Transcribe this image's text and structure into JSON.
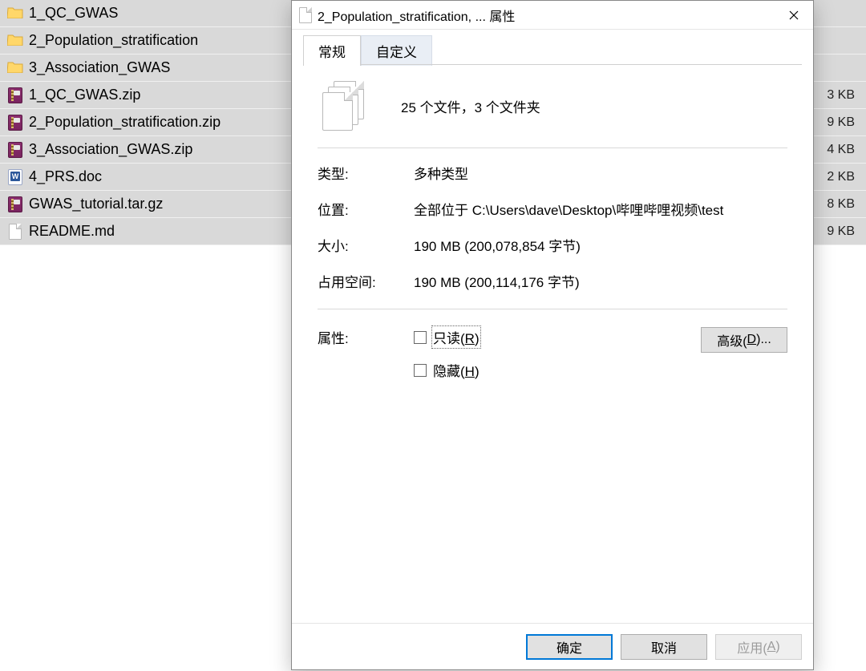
{
  "file_list": {
    "rows": [
      {
        "name": "1_QC_GWAS",
        "icon": "folder",
        "selected": true,
        "size": ""
      },
      {
        "name": "2_Population_stratification",
        "icon": "folder",
        "selected": true,
        "size": ""
      },
      {
        "name": "3_Association_GWAS",
        "icon": "folder",
        "selected": true,
        "size": ""
      },
      {
        "name": "1_QC_GWAS.zip",
        "icon": "archive",
        "selected": true,
        "size": "3 KB"
      },
      {
        "name": "2_Population_stratification.zip",
        "icon": "archive",
        "selected": true,
        "size": "9 KB"
      },
      {
        "name": "3_Association_GWAS.zip",
        "icon": "archive",
        "selected": true,
        "size": "4 KB"
      },
      {
        "name": "4_PRS.doc",
        "icon": "doc",
        "selected": true,
        "size": "2 KB"
      },
      {
        "name": "GWAS_tutorial.tar.gz",
        "icon": "archive",
        "selected": true,
        "size": "8 KB"
      },
      {
        "name": "README.md",
        "icon": "file",
        "selected": true,
        "size": "9 KB"
      }
    ]
  },
  "dialog": {
    "title": "2_Population_stratification, ... 属性",
    "tabs": {
      "general": "常规",
      "custom": "自定义"
    },
    "summary": "25 个文件，3 个文件夹",
    "labels": {
      "type": "类型:",
      "location": "位置:",
      "size": "大小:",
      "size_on_disk": "占用空间:",
      "attributes": "属性:"
    },
    "values": {
      "type": "多种类型",
      "location": "全部位于 C:\\Users\\dave\\Desktop\\哔哩哔哩视频\\test",
      "size": "190 MB (200,078,854 字节)",
      "size_on_disk": "190 MB (200,114,176 字节)"
    },
    "checkboxes": {
      "readonly_prefix": "只读(",
      "readonly_key": "R",
      "readonly_suffix": ")",
      "hidden_prefix": "隐藏(",
      "hidden_key": "H",
      "hidden_suffix": ")"
    },
    "buttons": {
      "advanced_prefix": "高级(",
      "advanced_key": "D",
      "advanced_suffix": ")...",
      "ok": "确定",
      "cancel": "取消",
      "apply_prefix": "应用(",
      "apply_key": "A",
      "apply_suffix": ")"
    }
  }
}
